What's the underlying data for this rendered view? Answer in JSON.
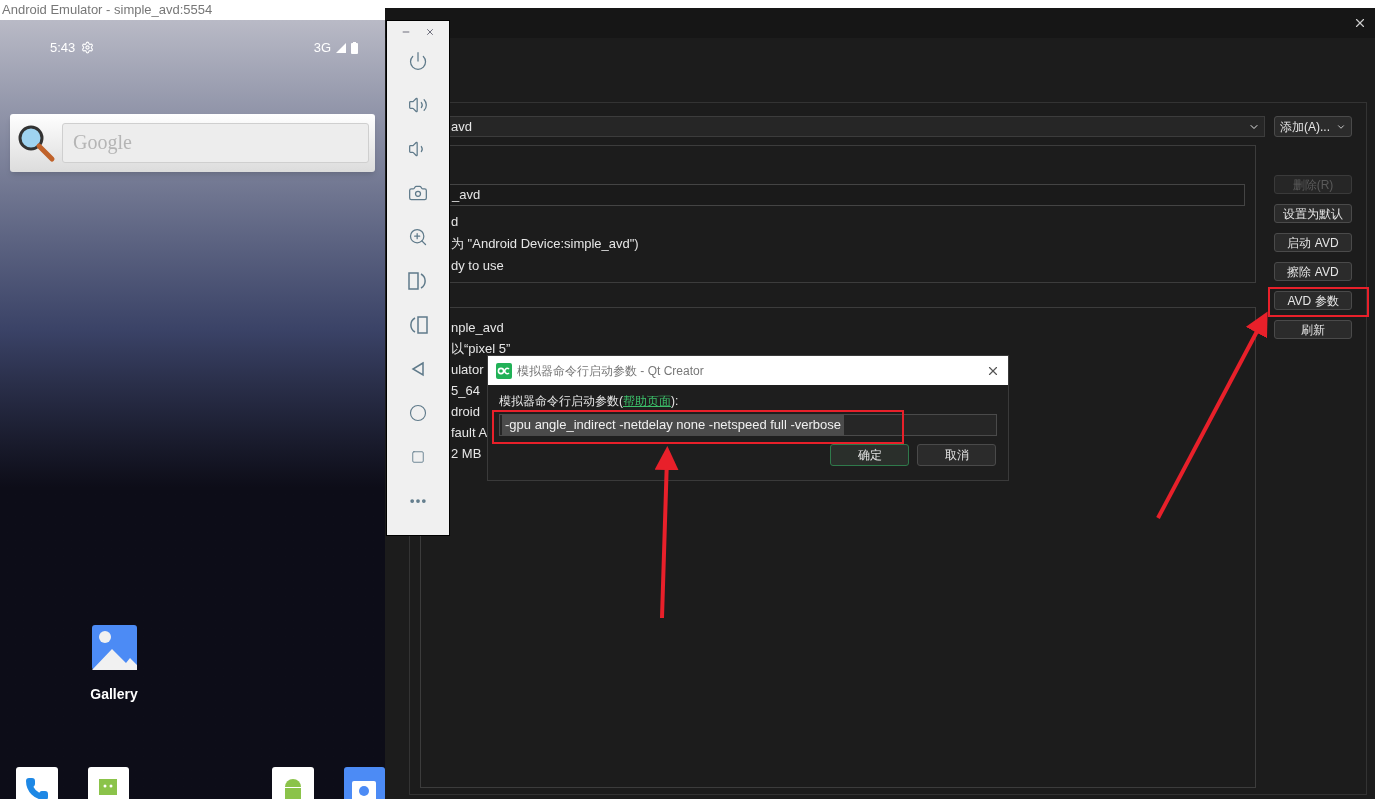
{
  "emulator": {
    "title": "Android Emulator - simple_avd:5554",
    "status_bar": {
      "time": "5:43",
      "network": "3G"
    },
    "search_widget": {
      "placeholder": "Google"
    },
    "apps": [
      {
        "label": "Gallery"
      }
    ]
  },
  "qt_window": {
    "avd_combo": {
      "value": "avd"
    },
    "add_button": "添加(A)...",
    "info_group": {
      "name_field": "_avd",
      "lines": [
        "d",
        "为 \"Android Device:simple_avd\")",
        "dy to use"
      ]
    },
    "details_group": {
      "lines": [
        "nple_avd",
        "以“pixel 5”",
        "ulator",
        "5_64",
        "droid",
        "fault A",
        "2 MB"
      ]
    },
    "buttons": [
      {
        "label": "删除(R)",
        "disabled": true
      },
      {
        "label": "设置为默认",
        "disabled": false
      },
      {
        "label": "启动 AVD",
        "disabled": false
      },
      {
        "label": "擦除 AVD",
        "disabled": false
      },
      {
        "label": "AVD 参数",
        "disabled": false
      },
      {
        "label": "刷新",
        "disabled": false
      }
    ]
  },
  "dialog": {
    "title": "模拟器命令行启动参数 - Qt Creator",
    "label": "模拟器命令行启动参数(",
    "link": "帮助页面",
    "label_suffix": "):",
    "value": "-gpu angle_indirect -netdelay none -netspeed full -verbose",
    "buttons": [
      {
        "label": "确定",
        "default": true
      },
      {
        "label": "取消",
        "default": false
      }
    ]
  }
}
